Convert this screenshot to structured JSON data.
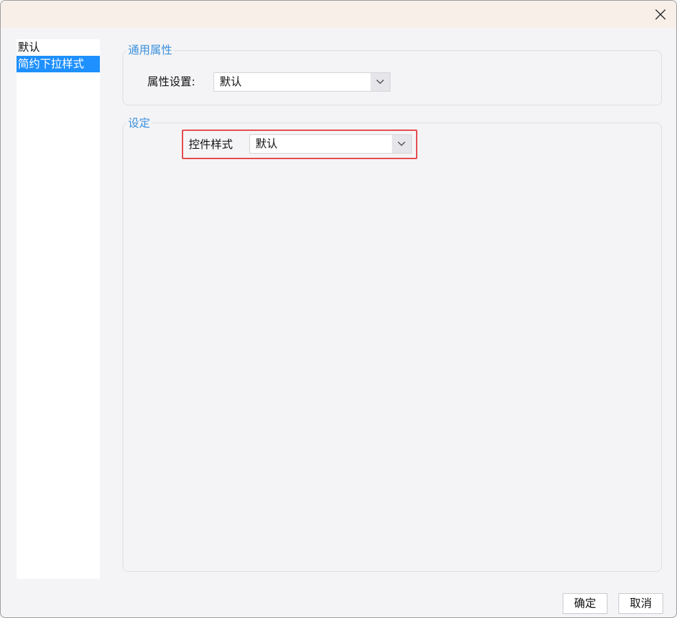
{
  "dialog": {
    "close_icon": "close-icon"
  },
  "sidebar": {
    "items": [
      {
        "label": "默认",
        "selected": false
      },
      {
        "label": "简约下拉样式",
        "selected": true
      }
    ]
  },
  "general": {
    "legend": "通用属性",
    "property_label": "属性设置:",
    "property_value": "默认"
  },
  "settings": {
    "legend": "设定",
    "control_style_label": "控件样式",
    "control_style_value": "默认"
  },
  "footer": {
    "ok_label": "确定",
    "cancel_label": "取消"
  },
  "colors": {
    "accent": "#3a8fdc",
    "selection": "#1e90ff",
    "highlight": "#e5484d"
  }
}
